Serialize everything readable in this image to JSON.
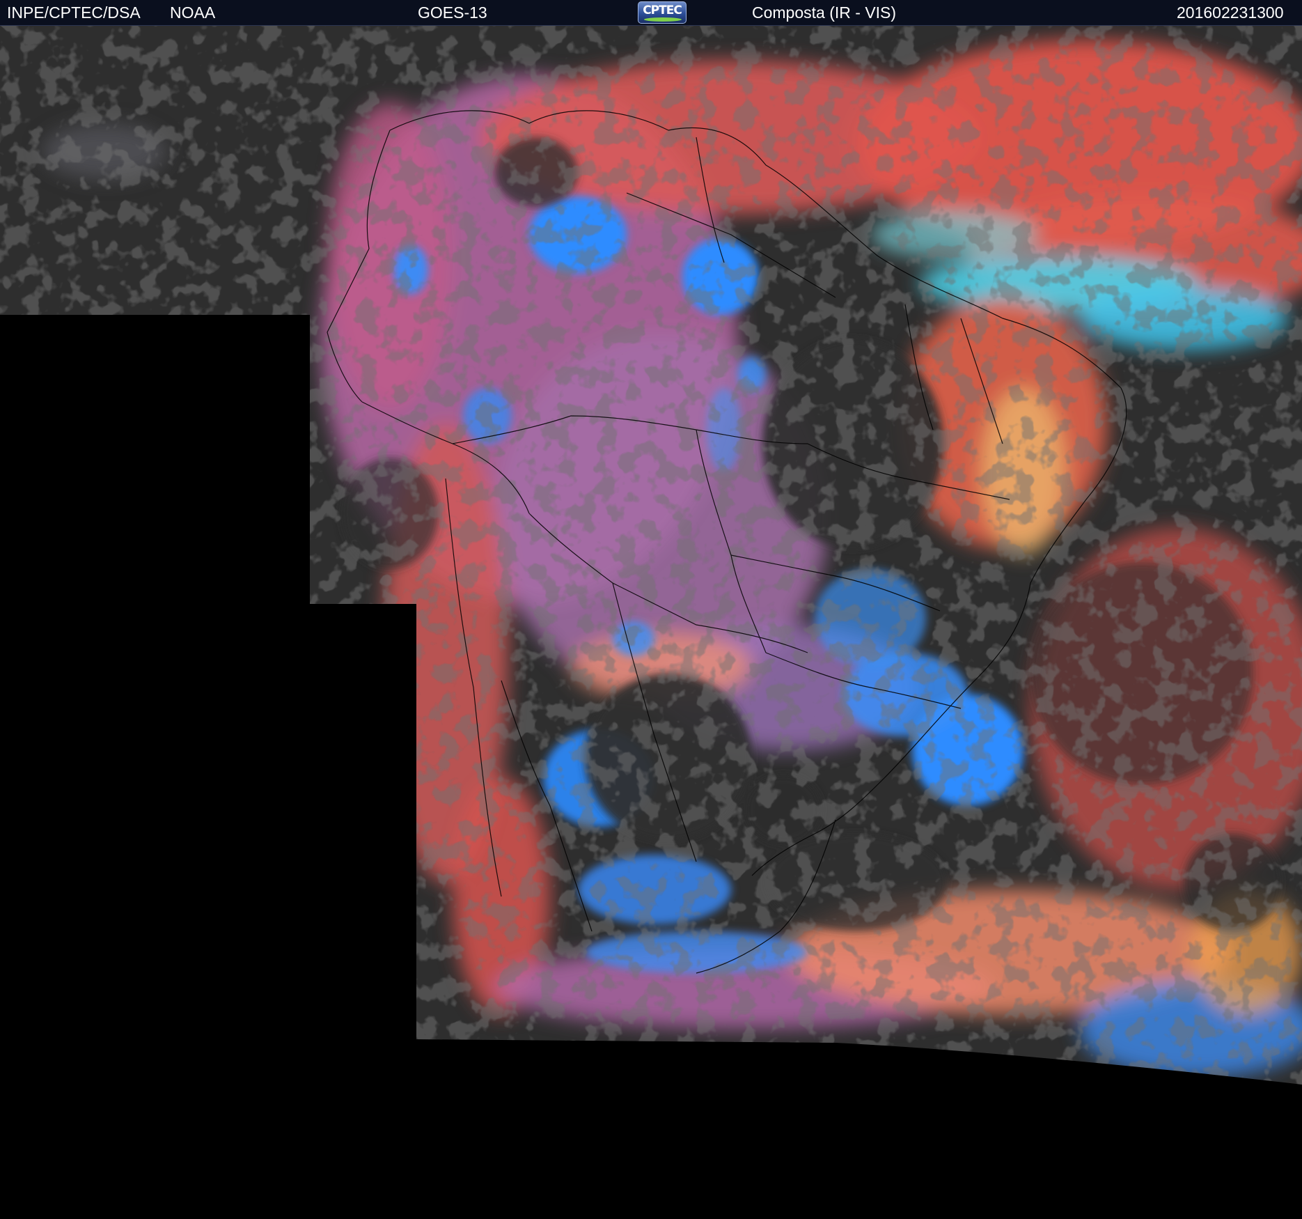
{
  "header": {
    "source": "INPE/CPTEC/DSA",
    "agency": "NOAA",
    "satellite": "GOES-13",
    "logo_text": "CPTEC",
    "product": "Composta (IR - VIS)",
    "timestamp": "201602231300"
  },
  "colors": {
    "header_background": "#0a0f1e",
    "header_text": "#ffffff",
    "no_data": "#000000",
    "clear_sky": "#2e2e2e",
    "low_cloud": "#e0554c",
    "mid_cloud": "#b065a0",
    "high_cloud": "#2d8cff",
    "mixed_cloud": "#ffa070",
    "borders": "#000000"
  },
  "icons": {
    "logo": "cptec-logo-icon"
  }
}
